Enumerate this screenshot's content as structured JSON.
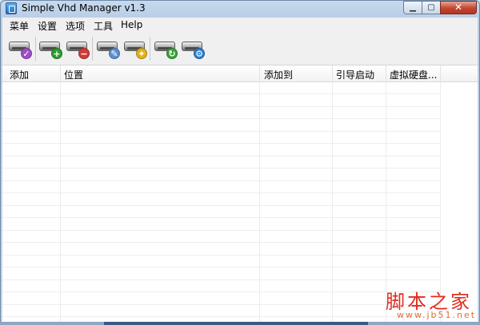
{
  "window": {
    "title": "Simple Vhd Manager v1.3"
  },
  "menu": [
    "菜单",
    "设置",
    "选项",
    "工具",
    "Help"
  ],
  "toolbar": [
    {
      "name": "check-drive",
      "badge": "✓",
      "color": "#9b4fc4"
    },
    {
      "name": "add-drive",
      "badge": "+",
      "color": "#2f9a2f"
    },
    {
      "name": "remove-drive",
      "badge": "−",
      "color": "#d23b3b"
    },
    {
      "name": "edit-drive",
      "badge": "✎",
      "color": "#5a8fd0"
    },
    {
      "name": "magic-drive",
      "badge": "✦",
      "color": "#e2b21c"
    },
    {
      "name": "refresh-drive",
      "badge": "↻",
      "color": "#3aa23a"
    },
    {
      "name": "settings-drive",
      "badge": "⚙",
      "color": "#2d7fcf"
    }
  ],
  "table": {
    "columns": [
      "添加",
      "位置",
      "添加到",
      "引导启动",
      "虚拟硬盘..."
    ],
    "rows": []
  },
  "watermark": {
    "cn": "脚本之家",
    "url": "www.jb51.net"
  }
}
